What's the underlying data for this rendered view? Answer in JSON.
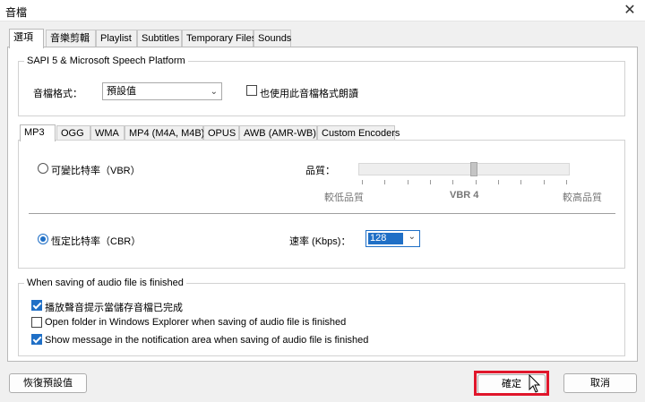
{
  "window": {
    "title": "音檔",
    "close_glyph": "✕"
  },
  "main_tabs": [
    {
      "label": "選項",
      "active": true
    },
    {
      "label": "音樂剪輯",
      "active": false
    },
    {
      "label": "Playlist",
      "active": false
    },
    {
      "label": "Subtitles",
      "active": false
    },
    {
      "label": "Temporary Files",
      "active": false
    },
    {
      "label": "Sounds",
      "active": false
    }
  ],
  "sapi_group": {
    "legend": "SAPI 5 & Microsoft Speech Platform",
    "format_label": "音檔格式：",
    "format_value": "預設值",
    "also_use_label": "也使用此音檔格式朗讀",
    "also_use_checked": false
  },
  "format_tabs": [
    {
      "label": "MP3",
      "active": true
    },
    {
      "label": "OGG",
      "active": false
    },
    {
      "label": "WMA",
      "active": false
    },
    {
      "label": "MP4 (M4A, M4B)",
      "active": false
    },
    {
      "label": "OPUS",
      "active": false
    },
    {
      "label": "AWB (AMR-WB)",
      "active": false
    },
    {
      "label": "Custom Encoders",
      "active": false
    }
  ],
  "mp3": {
    "vbr_label": "可變比特率（VBR）",
    "vbr_selected": false,
    "quality_label": "品質：",
    "quality_low": "較低品質",
    "quality_mid": "VBR 4",
    "quality_high": "較高品質",
    "quality_position": 0.55,
    "cbr_label": "恆定比特率（CBR）",
    "cbr_selected": true,
    "rate_label": "速率 (Kbps)：",
    "rate_value": "128"
  },
  "finish_group": {
    "legend": "When saving of audio file is finished",
    "options": [
      {
        "label": "播放聲音提示當儲存音檔已完成",
        "checked": true
      },
      {
        "label": "Open folder in Windows Explorer when saving of audio file is finished",
        "checked": false
      },
      {
        "label": "Show message in the notification area when saving of audio file is finished",
        "checked": true
      }
    ]
  },
  "buttons": {
    "restore_defaults": "恢復預設值",
    "ok": "確定",
    "cancel": "取消"
  },
  "colors": {
    "accent": "#1f6fc6",
    "highlight": "#e0162b"
  }
}
